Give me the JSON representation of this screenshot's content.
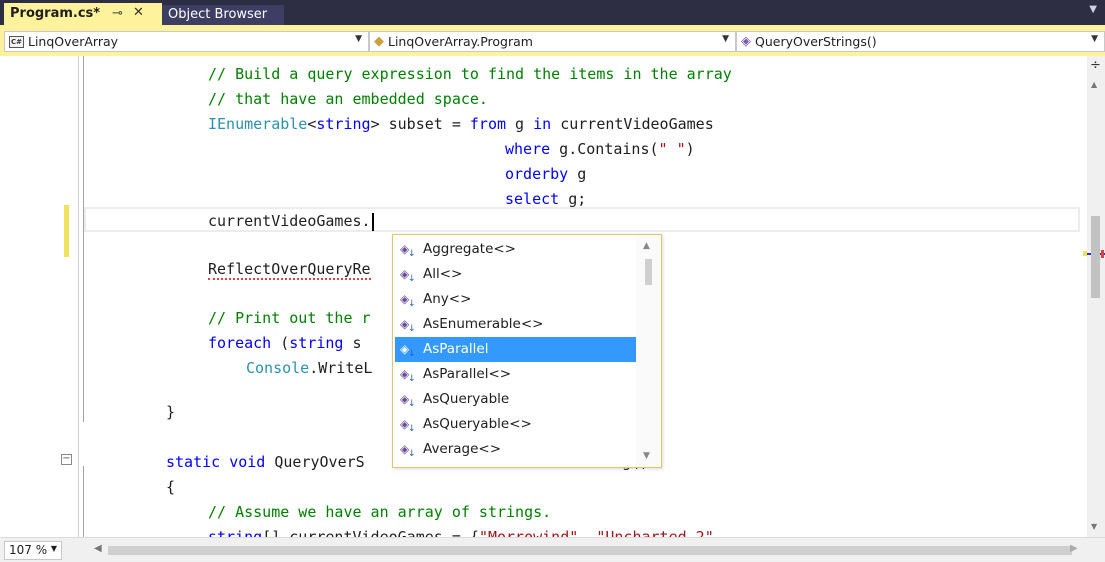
{
  "tabs": [
    {
      "label": "Program.cs*",
      "active": true
    },
    {
      "label": "Object Browser",
      "active": false
    }
  ],
  "tab_icons": {
    "pin": "⊸",
    "close": "✕",
    "menu": "▼"
  },
  "navbar": {
    "project": "LinqOverArray",
    "type": "LinqOverArray.Program",
    "member": "QueryOverStrings()"
  },
  "code_lines": {
    "l1": "// Build a query expression to find the items in the array",
    "l2": "// that have an embedded space.",
    "l3_type": "IEnumerable",
    "l3_lt": "<",
    "l3_kw": "string",
    "l3_rest": "> subset = ",
    "l3_from": "from",
    "l3_g": " g ",
    "l3_in": "in",
    "l3_tail": " currentVideoGames",
    "l4_kw": "where",
    "l4_a": " g.Contains(",
    "l4_str": "\" \"",
    "l4_b": ")",
    "l5_kw": "orderby",
    "l5_rest": " g",
    "l6_kw": "select",
    "l6_rest": " g;",
    "l7": "currentVideoGames.",
    "l8": "ReflectOverQueryRe",
    "l9": "// Print out the r",
    "l10_kw": "foreach",
    "l10_a": " (",
    "l10_kw2": "string",
    "l10_b": " s",
    "l11_type": "Console",
    "l11_rest": ".WriteL",
    "l12": "}",
    "l13_kw1": "static",
    "l13_sp": " ",
    "l13_kw2": "void",
    "l13_rest": " QueryOverS",
    "l13_tail": "g",
    "l13_end": "()",
    "l14": "{",
    "l15": "// Assume we have an array of strings.",
    "l16_kw": "string",
    "l16_a": "[] currentVideoGames = {",
    "l16_s1": "\"Morrowind\"",
    "l16_b": ", ",
    "l16_s2": "\"Uncharted 2\"",
    "l16_c": ","
  },
  "completion": {
    "items": [
      {
        "label": "Aggregate<>",
        "selected": false
      },
      {
        "label": "All<>",
        "selected": false
      },
      {
        "label": "Any<>",
        "selected": false
      },
      {
        "label": "AsEnumerable<>",
        "selected": false
      },
      {
        "label": "AsParallel",
        "selected": true
      },
      {
        "label": "AsParallel<>",
        "selected": false
      },
      {
        "label": "AsQueryable",
        "selected": false
      },
      {
        "label": "AsQueryable<>",
        "selected": false
      },
      {
        "label": "Average<>",
        "selected": false
      }
    ],
    "item_icon": "extension-method-icon"
  },
  "status": {
    "zoom": "107 %"
  },
  "colors": {
    "tab_active": "#fff29d",
    "tabstrip": "#2d2d44",
    "selection": "#3399ff",
    "comment": "#008000",
    "keyword": "#0000ff",
    "type": "#2b91af",
    "string": "#a31515"
  }
}
